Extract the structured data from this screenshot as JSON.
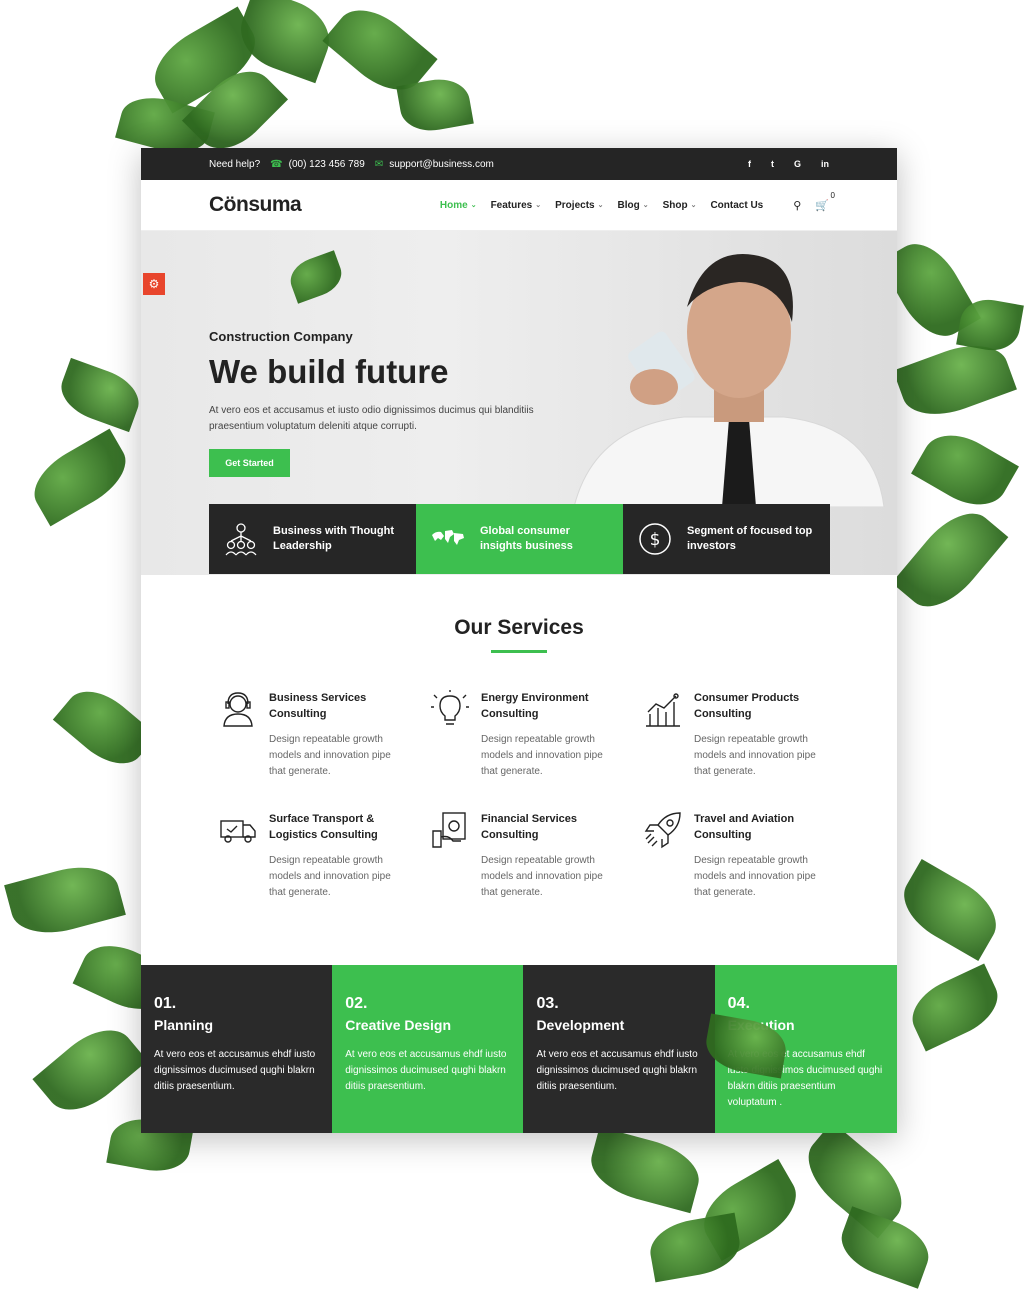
{
  "topbar": {
    "help_label": "Need help?",
    "phone": "(00) 123 456 789",
    "email": "support@business.com",
    "social": [
      "f",
      "t",
      "G",
      "in"
    ]
  },
  "nav": {
    "logo": "Cönsuma",
    "items": [
      {
        "label": "Home",
        "active": true,
        "dropdown": true
      },
      {
        "label": "Features",
        "active": false,
        "dropdown": true
      },
      {
        "label": "Projects",
        "active": false,
        "dropdown": true
      },
      {
        "label": "Blog",
        "active": false,
        "dropdown": true
      },
      {
        "label": "Shop",
        "active": false,
        "dropdown": true
      },
      {
        "label": "Contact Us",
        "active": false,
        "dropdown": false
      }
    ],
    "cart_count": "0"
  },
  "hero": {
    "subtitle": "Construction Company",
    "title": "We build future",
    "text": "At vero eos et accusamus et iusto odio dignissimos ducimus qui blanditiis praesentium voluptatum deleniti atque corrupti.",
    "cta": "Get Started"
  },
  "features": [
    {
      "text": "Business with Thought Leadership",
      "icon": "people-network-icon"
    },
    {
      "text": "Global consumer insights business",
      "icon": "world-map-icon"
    },
    {
      "text": "Segment of focused top investors",
      "icon": "dollar-cycle-icon"
    }
  ],
  "services": {
    "title": "Our Services",
    "items": [
      {
        "title": "Business Services Consulting",
        "desc": "Design repeatable growth models and innovation pipe that generate.",
        "icon": "headset-person-icon"
      },
      {
        "title": "Energy Environment Consulting",
        "desc": "Design repeatable growth models and innovation pipe that generate.",
        "icon": "lightbulb-icon"
      },
      {
        "title": "Consumer Products Consulting",
        "desc": "Design repeatable growth models and innovation pipe that generate.",
        "icon": "growth-chart-icon"
      },
      {
        "title": "Surface Transport & Logistics Consulting",
        "desc": "Design repeatable growth models and innovation pipe that generate.",
        "icon": "truck-icon"
      },
      {
        "title": "Financial Services Consulting",
        "desc": "Design repeatable growth models and innovation pipe that generate.",
        "icon": "money-hand-icon"
      },
      {
        "title": "Travel and Aviation Consulting",
        "desc": "Design repeatable growth models and innovation pipe that generate.",
        "icon": "rocket-icon"
      }
    ]
  },
  "process": [
    {
      "num": "01.",
      "name": "Planning",
      "desc": "At vero eos et accusamus ehdf iusto dignissimos ducimused qughi blakrn ditiis praesentium."
    },
    {
      "num": "02.",
      "name": "Creative Design",
      "desc": "At vero eos et accusamus ehdf iusto dignissimos ducimused qughi blakrn ditiis praesentium."
    },
    {
      "num": "03.",
      "name": "Development",
      "desc": "At vero eos et accusamus ehdf iusto dignissimos ducimused qughi blakrn ditiis praesentium."
    },
    {
      "num": "04.",
      "name": "Execution",
      "desc": "At vero eos et accusamus ehdf iusto dignissimos ducimused qughi blakrn ditiis praesentium voluptatum ."
    }
  ],
  "colors": {
    "accent": "#3dbf4f",
    "dark": "#252525",
    "gear": "#e8452c"
  }
}
